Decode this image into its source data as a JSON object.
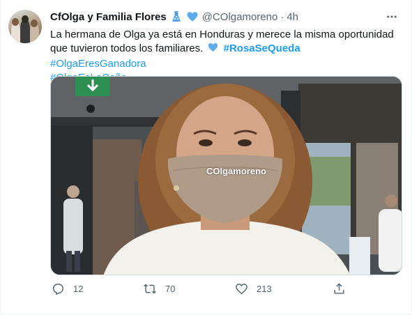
{
  "tweet": {
    "author_name": "CfOlga y Familia Flores",
    "author_emoji": [
      "dress-icon",
      "blue-heart-icon"
    ],
    "handle": "@COlgamoreno",
    "separator": "·",
    "time": "4h",
    "text_line1": "La hermana de Olga ya está en Honduras y merece la misma oportunidad",
    "text_line2": "que tuvieron todos los familiares.",
    "hashtags": [
      "#RosaSeQueda",
      "#OlgaEresGanadora",
      "#OlgaEsLaCaña"
    ],
    "media": {
      "watermark": "COlgamoreno"
    },
    "stats": {
      "replies": "12",
      "retweets": "70",
      "likes": "213"
    }
  },
  "colors": {
    "link": "#1d9bf0",
    "secondary_text": "#536471",
    "primary_text": "#0f1419"
  }
}
